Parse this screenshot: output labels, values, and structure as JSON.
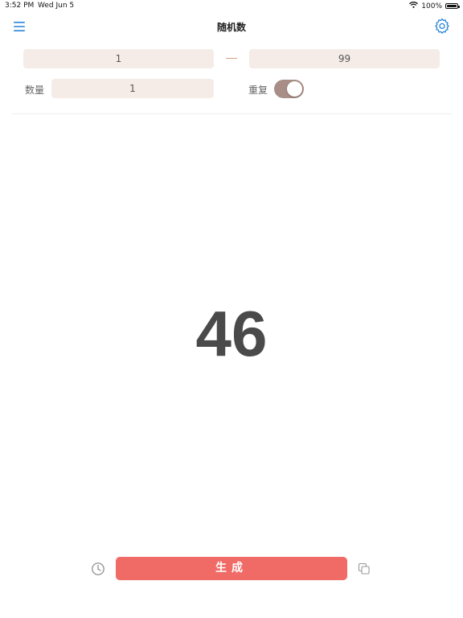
{
  "status_bar": {
    "time": "3:52 PM",
    "date": "Wed Jun 5",
    "battery": "100%",
    "battery_level": 1.0
  },
  "nav": {
    "title": "随机数",
    "menu_icon": "hamburger-menu-icon",
    "settings_icon": "gear-icon"
  },
  "range": {
    "min_value": "1",
    "max_value": "99",
    "separator": "—"
  },
  "count": {
    "label": "数量",
    "value": "1"
  },
  "repeat": {
    "label": "重复",
    "enabled": true
  },
  "result": {
    "value": "46"
  },
  "actions": {
    "generate_label": "生成",
    "history_icon": "clock-icon",
    "copy_icon": "copy-icon"
  },
  "colors": {
    "accent_blue": "#2a84d8",
    "generate_button": "#f06a66",
    "field_background": "#f5ece8",
    "toggle_on": "#a88e86",
    "result_text": "#4a4a4a"
  }
}
